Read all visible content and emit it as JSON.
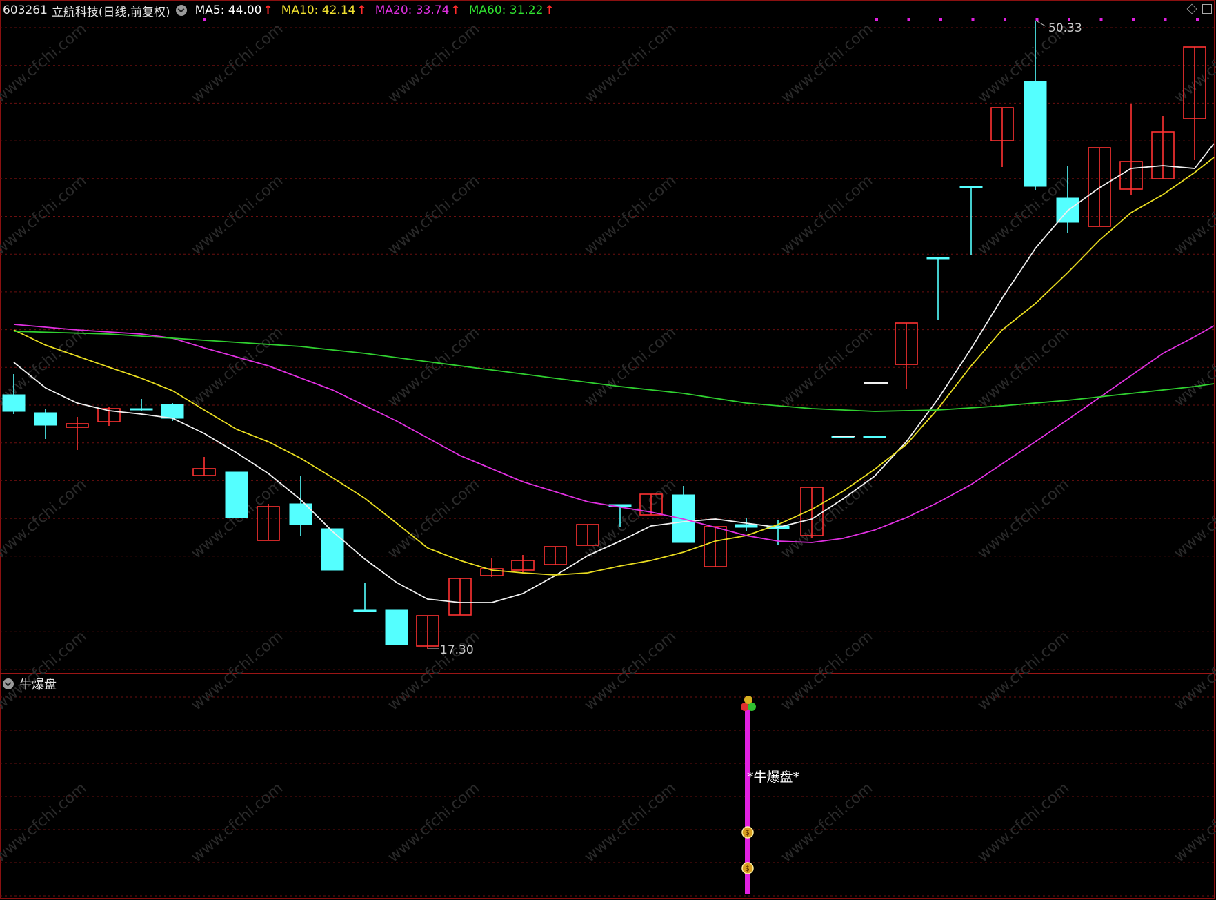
{
  "header": {
    "code": "603261",
    "name": "立航科技",
    "period": "(日线,前复权)",
    "ma": [
      {
        "label": "MA5: 44.00",
        "color": "#ffffff"
      },
      {
        "label": "MA10: 42.14",
        "color": "#f0e030"
      },
      {
        "label": "MA20: 33.74",
        "color": "#e030e0"
      },
      {
        "label": "MA60: 31.22",
        "color": "#30e030"
      }
    ]
  },
  "indicator": {
    "title": "牛爆盘",
    "signal_label": "*牛爆盘*"
  },
  "annotations": {
    "high_label": "50.33",
    "low_label": "17.30"
  },
  "watermark": "www.cfchi.com",
  "colors": {
    "up": "#ff3232",
    "down": "#54ffff",
    "grid": "#6a0f0f",
    "signal": "#e020e0"
  }
}
